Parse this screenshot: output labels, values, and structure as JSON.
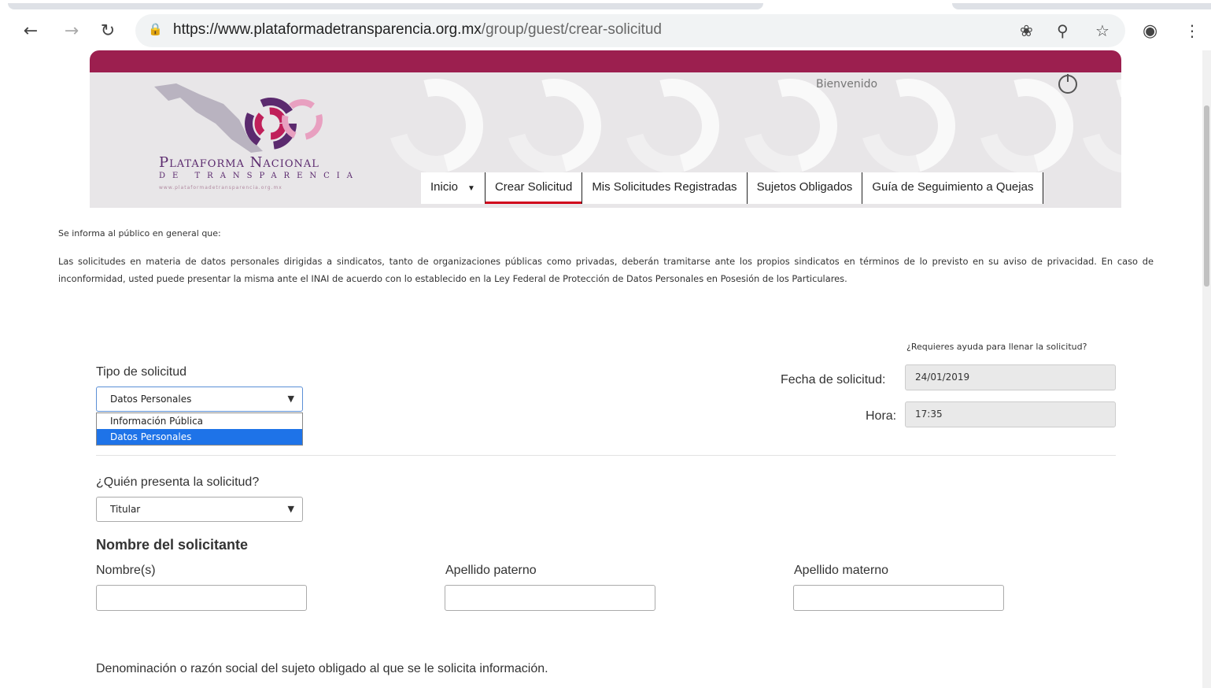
{
  "browser": {
    "url_host": "https://www.plataformadetransparencia.org.mx",
    "url_path": "/group/guest/crear-solicitud",
    "icons": [
      "back-icon",
      "forward-icon",
      "reload-icon",
      "lock-icon",
      "cookie-icon",
      "zoom-icon",
      "star-icon",
      "account-icon",
      "menu-icon"
    ]
  },
  "header": {
    "brand_line1": "Plataforma Nacional",
    "brand_line2": "de Transparencia",
    "brand_line3": "www.plataformadetransparencia.org.mx",
    "welcome": "Bienvenido",
    "accent_color": "#9c1f4f",
    "nav": [
      {
        "label": "Inicio"
      },
      {
        "label": "Crear Solicitud"
      },
      {
        "label": "Mis Solicitudes Registradas"
      },
      {
        "label": "Sujetos Obligados"
      },
      {
        "label": "Guía de Seguimiento a Quejas"
      }
    ]
  },
  "notice": {
    "intro": "Se informa al público en general que:",
    "body": "Las solicitudes en materia de datos personales dirigidas a sindicatos, tanto de organizaciones públicas como privadas, deberán tramitarse ante los propios sindicatos en términos de lo previsto en su aviso de privacidad. En caso de inconformidad, usted puede presentar la misma ante el INAI de acuerdo con lo establecido en la Ley Federal de Protección de Datos Personales en Posesión de los Particulares."
  },
  "form": {
    "help_link": "¿Requieres ayuda para llenar la solicitud?",
    "tipo_label": "Tipo de solicitud",
    "tipo_value": "Datos Personales",
    "tipo_options": [
      "Información Pública",
      "Datos Personales"
    ],
    "fecha_label": "Fecha de solicitud:",
    "fecha_value": "24/01/2019",
    "hora_label": "Hora:",
    "hora_value": "17:35",
    "quien_label": "¿Quién presenta la solicitud?",
    "quien_value": "Titular",
    "nombre_section": "Nombre del solicitante",
    "nombre_label": "Nombre(s)",
    "paterno_label": "Apellido paterno",
    "materno_label": "Apellido materno",
    "denominacion_label": "Denominación o razón social del sujeto obligado al que se le solicita información."
  }
}
